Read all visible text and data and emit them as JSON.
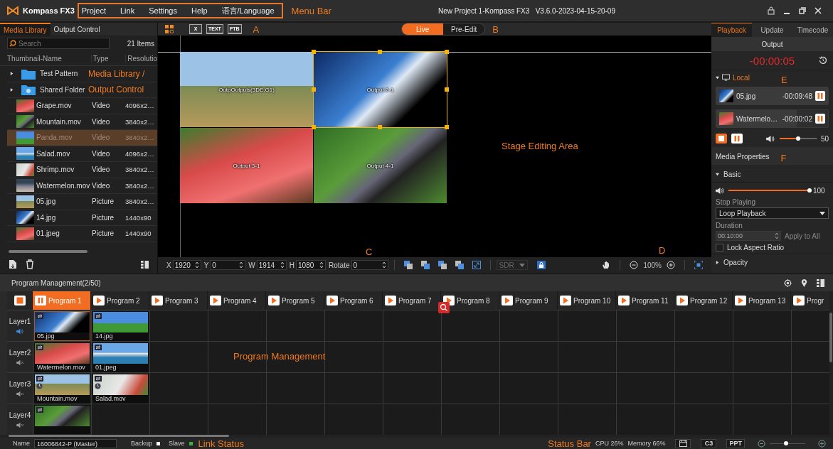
{
  "title_bar": {
    "app_name": "Kompass FX3",
    "menu": [
      {
        "label": "Project"
      },
      {
        "label": "Link"
      },
      {
        "label": "Settings"
      },
      {
        "label": "Help"
      },
      {
        "label": "语言/Language"
      }
    ],
    "annotation": "Menu Bar",
    "window_title": "New Project 1-Kompass FX3   V3.6.0-2023-04-15-20-09"
  },
  "left_panel": {
    "tabs": [
      {
        "label": "Media Library",
        "selected": true
      },
      {
        "label": "Output Control",
        "selected": false
      }
    ],
    "search": {
      "placeholder": "Search"
    },
    "item_count": "21 Items",
    "columns": [
      "Thumbnail-Name",
      "Type",
      "Resolutio"
    ],
    "rows": [
      {
        "kind": "folder",
        "name": "Test Pattern",
        "expanded": false,
        "note": "Media Library /"
      },
      {
        "kind": "folder",
        "name": "Shared Folder",
        "expanded": false,
        "note": "Output Control"
      },
      {
        "kind": "media",
        "name": "Grape.mov",
        "type": "Video",
        "resolution": "4096x2…",
        "selected": false
      },
      {
        "kind": "media",
        "name": "Mountain.mov",
        "type": "Video",
        "resolution": "3840x2…",
        "selected": false
      },
      {
        "kind": "media",
        "name": "Panda.mov",
        "type": "Video",
        "resolution": "3840x2…",
        "selected": true
      },
      {
        "kind": "media",
        "name": "Salad.mov",
        "type": "Video",
        "resolution": "4096x2…",
        "selected": false
      },
      {
        "kind": "media",
        "name": "Shrimp.mov",
        "type": "Video",
        "resolution": "3840x2…",
        "selected": false
      },
      {
        "kind": "media",
        "name": "Watermelon.mov",
        "type": "Video",
        "resolution": "3840x2…",
        "selected": false
      },
      {
        "kind": "media",
        "name": "05.jpg",
        "type": "Picture",
        "resolution": "3840x2…",
        "selected": false
      },
      {
        "kind": "media",
        "name": "14.jpg",
        "type": "Picture",
        "resolution": "1440x90",
        "selected": false
      },
      {
        "kind": "media",
        "name": "01.jpeg",
        "type": "Picture",
        "resolution": "1440x90",
        "selected": false
      }
    ]
  },
  "view_toolbar": {
    "screen_buttons": [
      {
        "label": "X"
      },
      {
        "label": "TEXT"
      },
      {
        "label": "FTB"
      }
    ],
    "annotation_a": "A",
    "modes": [
      {
        "label": "Live",
        "selected": true
      },
      {
        "label": "Pre-Edit",
        "selected": false
      }
    ],
    "annotation_b": "B"
  },
  "stage": {
    "outputs": [
      {
        "label": "OutpOutpuls(3DE,G1)",
        "selected": false
      },
      {
        "label": "Output 2-1",
        "selected": true
      },
      {
        "label": "Output 3-1",
        "selected": false
      },
      {
        "label": "Output 4-1",
        "selected": false
      }
    ],
    "annotation": "Stage Editing Area",
    "annotation_c": "C",
    "annotation_d": "D"
  },
  "stage_toolbar": {
    "fields": [
      {
        "label": "X",
        "value": "1920"
      },
      {
        "label": "Y",
        "value": "0"
      },
      {
        "label": "W",
        "value": "1914"
      },
      {
        "label": "H",
        "value": "1080"
      },
      {
        "label": "Rotate",
        "value": "0"
      }
    ],
    "sdr": {
      "value": "SDR",
      "disabled": true
    },
    "zoom": "100%"
  },
  "right_panel": {
    "tabs": [
      {
        "label": "Playback",
        "selected": true
      },
      {
        "label": "Update",
        "selected": false
      },
      {
        "label": "Timecode",
        "selected": false
      }
    ],
    "output_header": "Output",
    "time": "-00:00:05",
    "local": {
      "label": "Local",
      "expanded": true,
      "annotation": "E"
    },
    "playing": [
      {
        "name": "05.jpg",
        "time": "-00:09:48",
        "level": 1
      },
      {
        "name": "Watermelo…",
        "time": "-00:00:02",
        "level": 0.72
      }
    ],
    "volume": {
      "level": 0.5,
      "reading": "50"
    },
    "media_properties": {
      "title": "Media Properties",
      "annotation": "F",
      "basic": {
        "label": "Basic",
        "expanded": true
      },
      "volume": {
        "level": 1,
        "reading": "100"
      },
      "stop_label": "Stop Playing",
      "stop_value": "Loop Playback",
      "duration_label": "Duration",
      "duration": {
        "value": "00:10:00",
        "disabled": true
      },
      "apply": "Apply to All",
      "lock": {
        "label": "Lock Aspect Ratio",
        "checked": false
      },
      "opacity": {
        "label": "Opacity",
        "expanded": false
      }
    }
  },
  "program": {
    "title": "Program Management(2/50)",
    "annotation": "Program Management",
    "programs": [
      {
        "label": "Program 1",
        "selected": true
      },
      {
        "label": "Program 2",
        "selected": false
      },
      {
        "label": "Program 3",
        "selected": false
      },
      {
        "label": "Program 4",
        "selected": false
      },
      {
        "label": "Program 5",
        "selected": false
      },
      {
        "label": "Program 6",
        "selected": false
      },
      {
        "label": "Program 7",
        "selected": false
      },
      {
        "label": "Program 8",
        "selected": false
      },
      {
        "label": "Program 9",
        "selected": false
      },
      {
        "label": "Program 10",
        "selected": false
      },
      {
        "label": "Program 11",
        "selected": false
      },
      {
        "label": "Program 12",
        "selected": false
      },
      {
        "label": "Program 13",
        "selected": false
      },
      {
        "label": "Progr",
        "selected": false
      }
    ],
    "layers": [
      {
        "label": "Layer1",
        "muted": false,
        "cells": [
          {
            "name": "05.jpg",
            "selected": true,
            "timed": false
          },
          {
            "name": "14.jpg",
            "selected": false,
            "timed": false
          }
        ]
      },
      {
        "label": "Layer2",
        "muted": true,
        "cells": [
          {
            "name": "Watermelon.mov",
            "selected": false,
            "timed": false
          },
          {
            "name": "01.jpeg",
            "selected": false,
            "timed": false
          }
        ]
      },
      {
        "label": "Layer3",
        "muted": true,
        "cells": [
          {
            "name": "Mountain.mov",
            "selected": false,
            "timed": true
          },
          {
            "name": "Salad.mov",
            "selected": false,
            "timed": true
          }
        ]
      },
      {
        "label": "Layer4",
        "muted": true,
        "cells": [
          {
            "selected": false,
            "timed": false
          }
        ]
      }
    ]
  },
  "status_bar": {
    "name_label": "Name",
    "name_value": "16006842-P (Master)",
    "indicators": [
      {
        "label": "Backup",
        "color": "#ffffff"
      },
      {
        "label": "Slave",
        "color": "#3cb043"
      }
    ],
    "annotation_link": "Link Status",
    "annotation_status": "Status Bar",
    "cpu": "CPU 26%",
    "memory": "Memory 66%",
    "buttons": [
      "C3",
      "PPT"
    ],
    "zoom": {
      "level": 0.45
    }
  }
}
